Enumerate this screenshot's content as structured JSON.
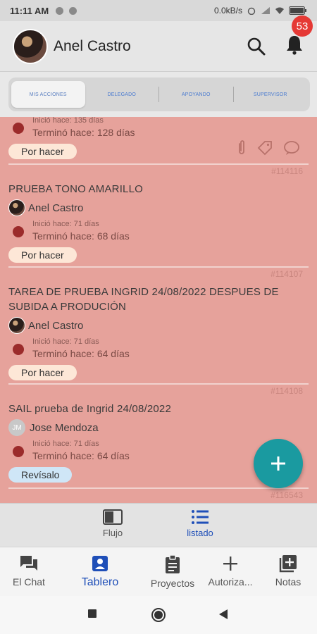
{
  "status_bar": {
    "time": "11:11 AM",
    "speed": "0.0kB/s"
  },
  "header": {
    "user_name": "Anel Castro",
    "notification_count": "53"
  },
  "tabs": [
    {
      "label": "MIS ACCIONES",
      "active": true
    },
    {
      "label": "DELEGADO",
      "active": false
    },
    {
      "label": "APOYANDO",
      "active": false
    },
    {
      "label": "SUPERVISOR",
      "active": false
    }
  ],
  "tasks": [
    {
      "id": "",
      "title": "",
      "assignee": "",
      "started": "Inició hace: 135 días",
      "ended": "Terminó hace: 128 días",
      "status": "Por hacer"
    },
    {
      "id": "#114116",
      "title": "PRUEBA TONO AMARILLO",
      "assignee": "Anel Castro",
      "started": "Inició hace: 71 días",
      "ended": "Terminó hace: 68 días",
      "status": "Por hacer"
    },
    {
      "id": "#114107",
      "title_line1": "TAREA DE PRUEBA INGRID 24/08/2022 DESPUES DE",
      "title_line2": "SUBIDA A PRODUCIÓN",
      "assignee": "Anel Castro",
      "started": "Inició hace: 71 días",
      "ended": "Terminó hace: 64 días",
      "status": "Por hacer"
    },
    {
      "id": "#114108",
      "title": "SAIL prueba de Ingrid 24/08/2022",
      "assignee": "Jose Mendoza",
      "assignee_initials": "JM",
      "started": "Inició hace: 71 días",
      "ended": "Terminó hace: 64 días",
      "status": "Revísalo"
    }
  ],
  "next_task_id": "#116543",
  "view_toggle": {
    "flow_label": "Flujo",
    "list_label": "listado",
    "active": "listado"
  },
  "bottom_nav": [
    {
      "label": "El Chat",
      "icon": "chat-icon"
    },
    {
      "label": "Tablero",
      "icon": "board-icon",
      "active": true
    },
    {
      "label": "Proyectos",
      "icon": "clipboard-icon"
    },
    {
      "label": "Autoriza...",
      "icon": "plus-icon"
    },
    {
      "label": "Notas",
      "icon": "add-note-icon"
    }
  ],
  "colors": {
    "list_bg": "#e6a29b",
    "accent": "#1f4fb8",
    "fab": "#1a9aa0",
    "badge": "#e53935",
    "status_dot": "#9b2b2b"
  }
}
